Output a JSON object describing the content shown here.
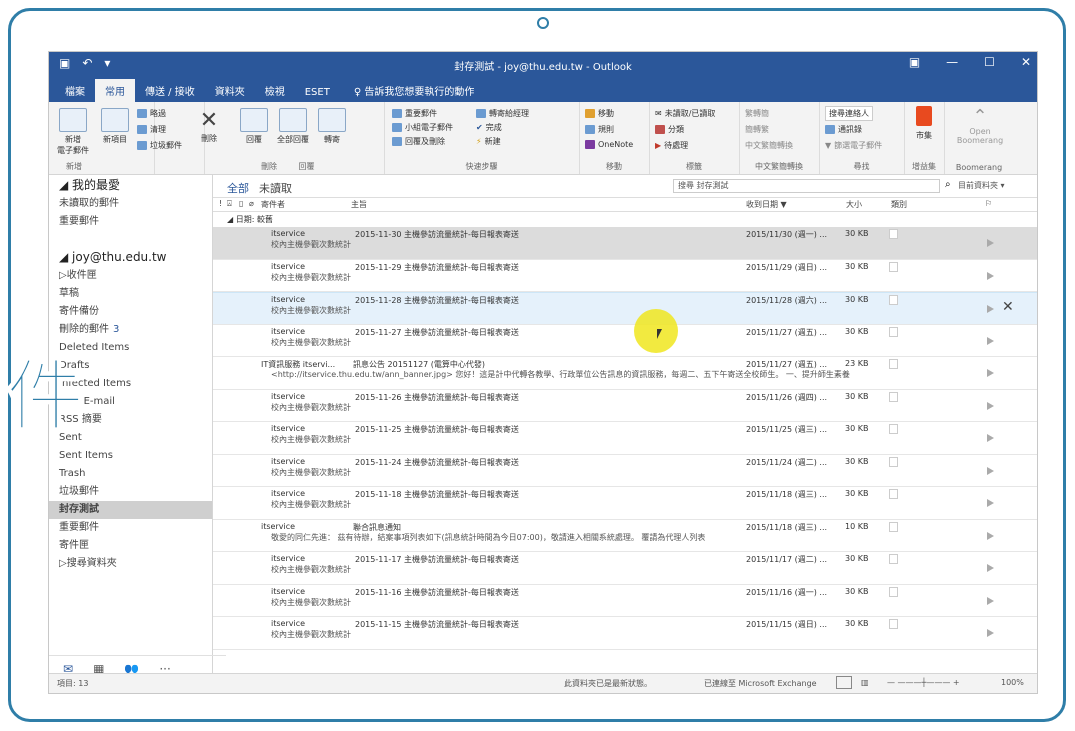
{
  "window": {
    "title": "封存測試 - joy@thu.edu.tw - Outlook",
    "qat_icons": [
      "save-icon",
      "undo-icon",
      "qat-more-icon"
    ],
    "controls": [
      "ribbon-display-icon",
      "minimize-icon",
      "restore-icon",
      "close-icon"
    ]
  },
  "tabs": [
    "檔案",
    "常用",
    "傳送 / 接收",
    "資料夾",
    "檢視",
    "ESET"
  ],
  "tell_me": "告訴我您想要執行的動作",
  "ribbon": {
    "new_email": "新增\n電子郵件",
    "new_items": "新項目",
    "ignore": "略過",
    "clean_up": "清理",
    "junk": "垃圾郵件",
    "delete": "刪除",
    "reply": "回覆",
    "reply_all": "全部回覆",
    "forward": "轉寄",
    "quick1": "重要郵件",
    "quick2": "小組電子郵件",
    "quick3": "回覆及刪除",
    "quick4": "轉寄給經理",
    "quick5": "完成",
    "quick6": "新建",
    "move": "移動",
    "rules": "規則",
    "onenote": "OneNote",
    "unread": "未讀取/已讀取",
    "categorize": "分類",
    "followup": "待處理",
    "tc1": "繁轉簡",
    "tc2": "簡轉繁",
    "tc3": "中文繁簡轉換",
    "search_people": "搜尋連絡人",
    "address_book": "通訊錄",
    "filter_email": "篩選電子郵件",
    "store": "市集",
    "open_boomerang": "Open\nBoomerang",
    "groups": [
      "新增",
      "刪除",
      "回覆",
      "快速步驟",
      "移動",
      "標籤",
      "中文繁簡轉換",
      "尋找",
      "增益集",
      "Boomerang"
    ]
  },
  "nav": {
    "favorites_header": "我的最愛",
    "favorites": [
      "未讀取的郵件",
      "重要郵件"
    ],
    "account": "joy@thu.edu.tw",
    "folders": [
      {
        "label": "收件匣",
        "count": ""
      },
      {
        "label": "草稿",
        "count": ""
      },
      {
        "label": "寄件備份",
        "count": ""
      },
      {
        "label": "刪除的郵件",
        "count": "3"
      },
      {
        "label": "Deleted Items",
        "count": ""
      },
      {
        "label": "Drafts",
        "count": ""
      },
      {
        "label": "Infected Items",
        "count": ""
      },
      {
        "label": "Junk E-mail",
        "count": ""
      },
      {
        "label": "RSS 摘要",
        "count": ""
      },
      {
        "label": "Sent",
        "count": ""
      },
      {
        "label": "Sent Items",
        "count": ""
      },
      {
        "label": "Trash",
        "count": ""
      },
      {
        "label": "垃圾郵件",
        "count": ""
      },
      {
        "label": "封存測試",
        "count": ""
      },
      {
        "label": "重要郵件",
        "count": ""
      },
      {
        "label": "寄件匣",
        "count": ""
      },
      {
        "label": "搜尋資料夾",
        "count": ""
      }
    ]
  },
  "list": {
    "filter_all": "全部",
    "filter_unread": "未讀取",
    "search_placeholder": "搜尋 封存測試",
    "scope": "目前資料夾",
    "headers": {
      "from": "寄件者",
      "subject": "主旨",
      "received": "收到日期 ▼",
      "size": "大小",
      "category": "類別"
    },
    "group": "日期: 較舊",
    "messages": [
      {
        "from": "itservice",
        "subject": "2015-11-30 主機參訪流量統計-每日報表寄送",
        "preview": "校內主機參觀次數統計",
        "date": "2015/11/30 (週一) ...",
        "size": "30 KB"
      },
      {
        "from": "itservice",
        "subject": "2015-11-29 主機參訪流量統計-每日報表寄送",
        "preview": "校內主機參觀次數統計",
        "date": "2015/11/29 (週日) ...",
        "size": "30 KB"
      },
      {
        "from": "itservice",
        "subject": "2015-11-28 主機參訪流量統計-每日報表寄送",
        "preview": "校內主機參觀次數統計",
        "date": "2015/11/28 (週六) ...",
        "size": "30 KB"
      },
      {
        "from": "itservice",
        "subject": "2015-11-27 主機參訪流量統計-每日報表寄送",
        "preview": "校內主機參觀次數統計",
        "date": "2015/11/27 (週五) ...",
        "size": "30 KB"
      },
      {
        "from": "IT資訊服務 itservi...",
        "subject": "訊息公告 20151127 (電算中心代發)",
        "preview": "<http://itservice.thu.edu.tw/ann_banner.jpg> 您好！這是計中代轉各教學、行政單位公告訊息的資訊服務，每週二、五下午寄送全校師生。 一、提升師生素養",
        "date": "2015/11/27 (週五) ...",
        "size": "23 KB"
      },
      {
        "from": "itservice",
        "subject": "2015-11-26 主機參訪流量統計-每日報表寄送",
        "preview": "校內主機參觀次數統計",
        "date": "2015/11/26 (週四) ...",
        "size": "30 KB"
      },
      {
        "from": "itservice",
        "subject": "2015-11-25 主機參訪流量統計-每日報表寄送",
        "preview": "校內主機參觀次數統計",
        "date": "2015/11/25 (週三) ...",
        "size": "30 KB"
      },
      {
        "from": "itservice",
        "subject": "2015-11-24 主機參訪流量統計-每日報表寄送",
        "preview": "校內主機參觀次數統計",
        "date": "2015/11/24 (週二) ...",
        "size": "30 KB"
      },
      {
        "from": "itservice",
        "subject": "2015-11-18 主機參訪流量統計-每日報表寄送",
        "preview": "校內主機參觀次數統計",
        "date": "2015/11/18 (週三) ...",
        "size": "30 KB"
      },
      {
        "from": "itservice",
        "subject": "聯合訊息通知",
        "preview": "敬愛的同仁先進： 茲有待辦，結案事項列表如下(訊息統計時間為今日07:00)，敬請進入相關系統處理。 覆請為代理人列表",
        "date": "2015/11/18 (週三) ...",
        "size": "10 KB"
      },
      {
        "from": "itservice",
        "subject": "2015-11-17 主機參訪流量統計-每日報表寄送",
        "preview": "校內主機參觀次數統計",
        "date": "2015/11/17 (週二) ...",
        "size": "30 KB"
      },
      {
        "from": "itservice",
        "subject": "2015-11-16 主機參訪流量統計-每日報表寄送",
        "preview": "校內主機參觀次數統計",
        "date": "2015/11/16 (週一) ...",
        "size": "30 KB"
      },
      {
        "from": "itservice",
        "subject": "2015-11-15 主機參訪流量統計-每日報表寄送",
        "preview": "校內主機參觀次數統計",
        "date": "2015/11/15 (週日) ...",
        "size": "30 KB"
      }
    ]
  },
  "status": {
    "items": "項目: 13",
    "uptodate": "此資料夾已是最新狀態。",
    "connected": "已連線至 Microsoft Exchange",
    "zoom": "100%"
  },
  "overlay_glyph": "件",
  "colors": {
    "accent": "#2b579a",
    "frame": "#2f7ea8"
  }
}
